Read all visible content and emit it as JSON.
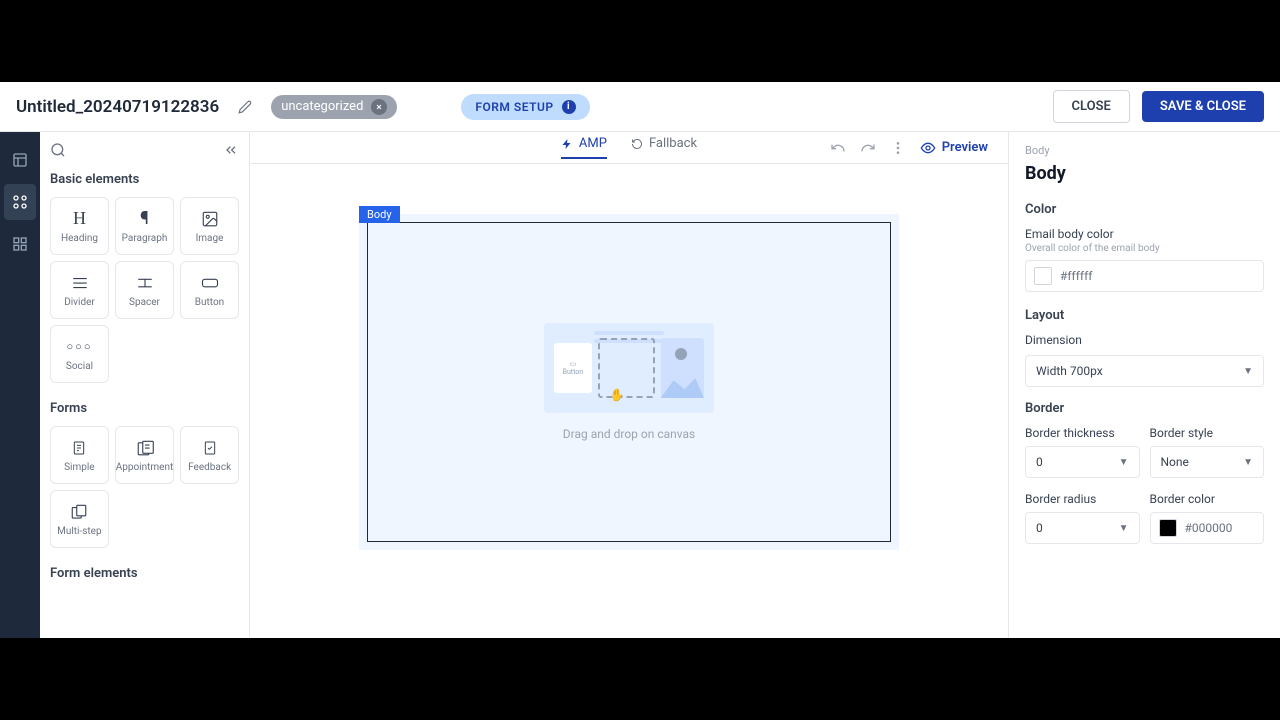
{
  "header": {
    "title": "Untitled_20240719122836",
    "tag": "uncategorized",
    "form_setup": "FORM SETUP",
    "close": "CLOSE",
    "save": "SAVE & CLOSE"
  },
  "tabs": {
    "amp": "AMP",
    "fallback": "Fallback",
    "preview": "Preview"
  },
  "elements": {
    "basic_title": "Basic elements",
    "forms_title": "Forms",
    "form_elements_title": "Form elements",
    "basic": [
      {
        "label": "Heading"
      },
      {
        "label": "Paragraph"
      },
      {
        "label": "Image"
      },
      {
        "label": "Divider"
      },
      {
        "label": "Spacer"
      },
      {
        "label": "Button"
      },
      {
        "label": "Social"
      }
    ],
    "forms": [
      {
        "label": "Simple"
      },
      {
        "label": "Appointment"
      },
      {
        "label": "Feedback"
      },
      {
        "label": "Multi-step"
      }
    ]
  },
  "canvas": {
    "body_tag": "Body",
    "drop_text": "Drag and drop on canvas",
    "illus_button": "Button"
  },
  "props": {
    "crumb": "Body",
    "title": "Body",
    "color_section": "Color",
    "email_body_label": "Email body color",
    "email_body_hint": "Overall color of the email body",
    "email_body_value": "#ffffff",
    "layout_section": "Layout",
    "dimension_label": "Dimension",
    "width_value": "Width 700px",
    "border_section": "Border",
    "thickness_label": "Border thickness",
    "thickness_value": "0",
    "style_label": "Border style",
    "style_value": "None",
    "radius_label": "Border radius",
    "radius_value": "0",
    "bcolor_label": "Border color",
    "bcolor_value": "#000000"
  }
}
